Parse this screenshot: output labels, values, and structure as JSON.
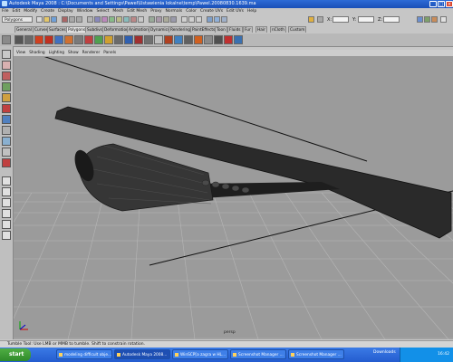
{
  "window": {
    "title": "Autodesk Maya 2008 : C:\\Documents and Settings\\Pawel\\Ustawienia lokalne\\temp\\Pawel.20080830.1639.ma",
    "buttons": [
      "_",
      "□",
      "×"
    ]
  },
  "menubar": [
    "File",
    "Edit",
    "Modify",
    "Create",
    "Display",
    "Window",
    "Select",
    "Mesh",
    "Edit Mesh",
    "Proxy",
    "Normals",
    "Color",
    "Create UVs",
    "Edit UVs",
    "Help"
  ],
  "statusline": {
    "mode": "Polygons",
    "x_label": "X:",
    "y_label": "Y:",
    "z_label": "Z:"
  },
  "shelf_tabs": [
    "General",
    "Curves",
    "Surfaces",
    "Polygons",
    "Subdivs",
    "Deformation",
    "Animation",
    "Dynamics",
    "Rendering",
    "PaintEffects",
    "Toon",
    "Fluids",
    "Fur",
    "Hair",
    "nCloth",
    "Custom"
  ],
  "active_tab_index": 3,
  "panel_menu": [
    "View",
    "Shading",
    "Lighting",
    "Show",
    "Renderer",
    "Panels"
  ],
  "viewport": {
    "camera": "persp"
  },
  "helpline": "Tumble Tool: Use LMB or MMB to tumble. Shift to constrain rotation.",
  "taskbar": {
    "start": "start",
    "buttons": [
      {
        "label": "modeling difficult obje..."
      },
      {
        "label": "Autodesk Maya 2008..."
      },
      {
        "label": "WinSCP[a zagra w HL..."
      },
      {
        "label": "Screenshot Manager ..."
      },
      {
        "label": "Screenshot Manager ..."
      }
    ],
    "downloads": "Downloads",
    "clock": "16:42"
  },
  "colors": {
    "titlebar": "#1f58c4",
    "viewport_bg": "#9b9b9b",
    "grid": "#b8b8b8",
    "model": "#2a2a2a",
    "taskbar": "#2a63d6"
  }
}
